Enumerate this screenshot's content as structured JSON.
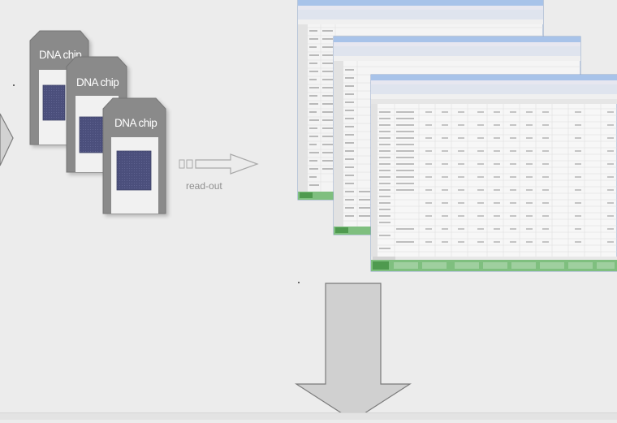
{
  "chips": {
    "labels": [
      "DNA chip",
      "DNA chip",
      "DNA chip"
    ]
  },
  "readout": {
    "label": "read-out"
  },
  "colors": {
    "background": "#ececec",
    "chip_body": "#858585",
    "chip_window": "#f0f0f0",
    "chip_square": "#4a4f7a",
    "arrow_fill": "#d0d0d0",
    "arrow_stroke": "#7a7a7a",
    "sheet_titlebar": "#a7c2e8",
    "sheet_taskbar": "#6fb36f"
  }
}
